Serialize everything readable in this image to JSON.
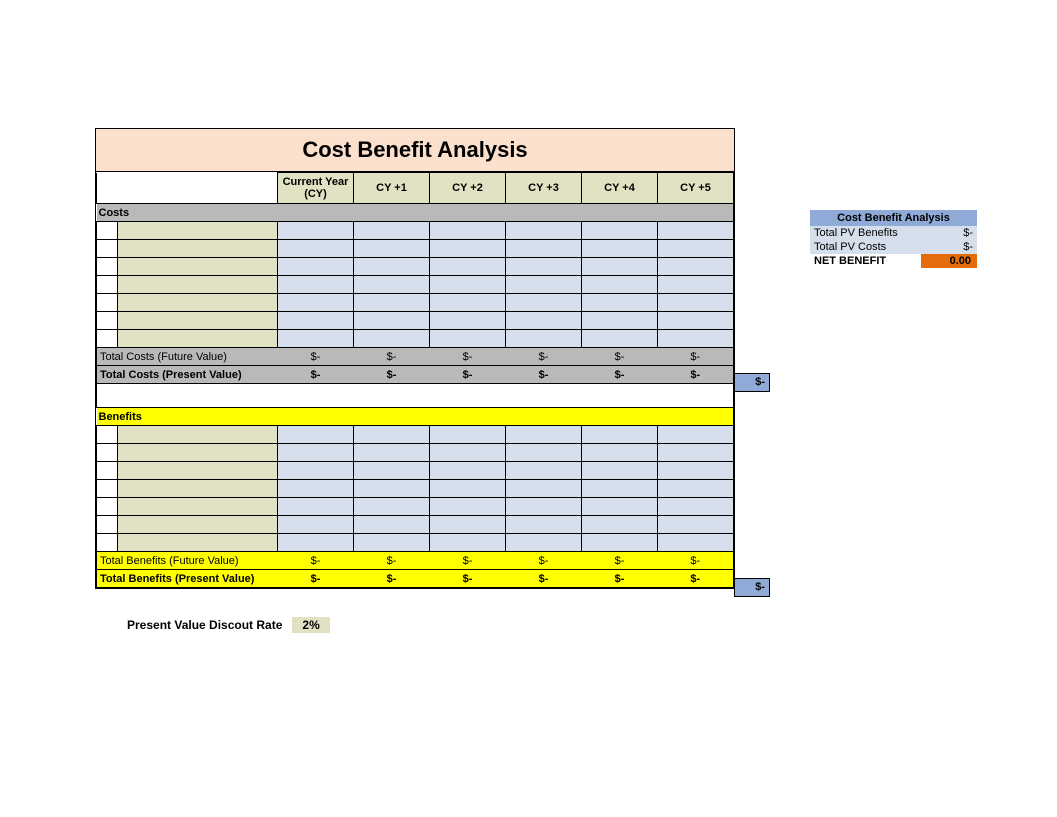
{
  "title": "Cost Benefit Analysis",
  "years": [
    "Current Year (CY)",
    "CY +1",
    "CY +2",
    "CY +3",
    "CY +4",
    "CY +5"
  ],
  "sections": {
    "costs_header": "Costs",
    "benefits_header": "Benefits"
  },
  "totals": {
    "costs_fv_label": "Total Costs (Future Value)",
    "costs_pv_label": "Total Costs (Present Value)",
    "benefits_fv_label": "Total Benefits (Future Value)",
    "benefits_pv_label": "Total Benefits (Present Value)",
    "dash": "$-"
  },
  "ext": {
    "costs_pv_total": "$-",
    "benefits_pv_total": "$-"
  },
  "side": {
    "title": "Cost Benefit Analysis",
    "pv_benefits_label": "Total PV Benefits",
    "pv_benefits_val": "$-",
    "pv_costs_label": "Total PV Costs",
    "pv_costs_val": "$-",
    "net_label": "NET BENEFIT",
    "net_val": "0.00"
  },
  "discount": {
    "label": "Present Value Discout Rate",
    "value": "2%"
  }
}
